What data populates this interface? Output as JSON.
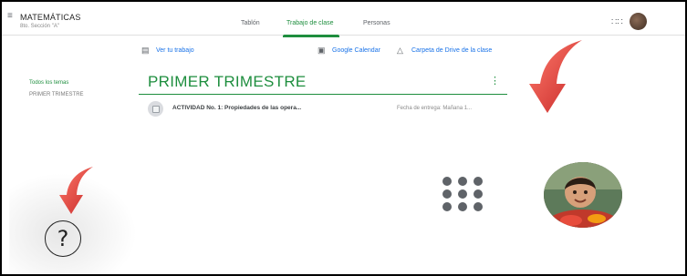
{
  "header": {
    "class_name": "MATEMÁTICAS",
    "class_section": "8to. Sección \"A\"",
    "tabs": [
      {
        "label": "Tablón",
        "active": false
      },
      {
        "label": "Trabajo de clase",
        "active": true
      },
      {
        "label": "Personas",
        "active": false
      }
    ],
    "apps_icon": "apps-grid-icon",
    "avatar": "user-avatar"
  },
  "actions": {
    "view_work": "Ver tu trabajo",
    "calendar": "Google Calendar",
    "drive": "Carpeta de Drive de la clase"
  },
  "sidebar": {
    "items": [
      {
        "label": "Todos los temas",
        "active": true
      },
      {
        "label": "PRIMER TRIMESTRE",
        "active": false
      }
    ]
  },
  "topic": {
    "title": "PRIMER TRIMESTRE",
    "items": [
      {
        "title": "ACTIVIDAD No. 1: Propiedades de las opera...",
        "due": "Fecha de entrega: Mañana 1..."
      }
    ]
  },
  "overlay": {
    "help_symbol": "?",
    "accent_color": "#1e8e3e",
    "arrow_color": "#e53935"
  }
}
